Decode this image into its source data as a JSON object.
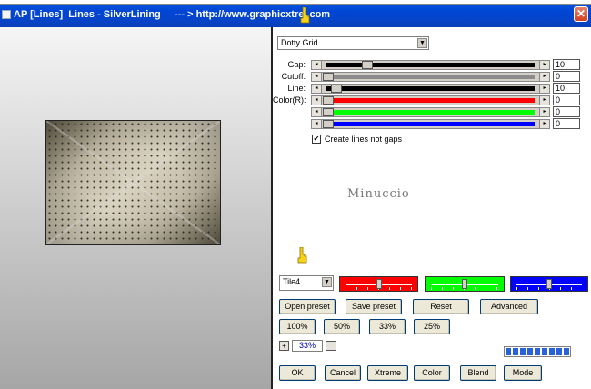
{
  "window": {
    "title": "AP [Lines]  Lines - SilverLining     --- > http://www.graphicxtre .com",
    "close_glyph": "✕"
  },
  "preset_dropdown": {
    "selected": "Dotty Grid",
    "arrow": "▼"
  },
  "sliders": [
    {
      "label": "Gap:",
      "value": "10",
      "color": "#000000",
      "fill": 0.19
    },
    {
      "label": "Cutoff:",
      "value": "0",
      "color": "#8c8c8c",
      "fill": 0.0
    },
    {
      "label": "Line:",
      "value": "10",
      "color": "#000000",
      "fill": 0.04
    },
    {
      "label": "Color(R):",
      "value": "0",
      "color": "#ff0000",
      "fill": 0.0
    },
    {
      "label": "",
      "value": "0",
      "color": "#00ff00",
      "fill": 0.0
    },
    {
      "label": "",
      "value": "0",
      "color": "#0000ff",
      "fill": 0.0
    }
  ],
  "checkbox": {
    "label": "Create lines not gaps",
    "checked": true,
    "mark": "✔"
  },
  "watermark": "Minuccio",
  "tile_dropdown": {
    "selected": "Tile4",
    "arrow": "▼"
  },
  "color_sliders": [
    {
      "color": "#ff0000",
      "position": 0.5
    },
    {
      "color": "#00ff00",
      "position": 0.5
    },
    {
      "color": "#0000ff",
      "position": 0.5
    }
  ],
  "buttons": {
    "open_preset": "Open preset",
    "save_preset": "Save preset",
    "reset": "Reset",
    "advanced": "Advanced",
    "zoom_100": "100%",
    "zoom_50": "50%",
    "zoom_33": "33%",
    "zoom_25": "25%",
    "ok": "OK",
    "cancel": "Cancel",
    "xtreme": "Xtreme",
    "color": "Color",
    "blend": "Blend",
    "mode": "Mode"
  },
  "zoom": {
    "plus": "+",
    "value": "33%"
  },
  "progress": {
    "fraction": 1.0
  },
  "icons": {
    "titlebar": "app-icon",
    "close": "close-icon",
    "pointer": "hand-pointer-icon"
  }
}
